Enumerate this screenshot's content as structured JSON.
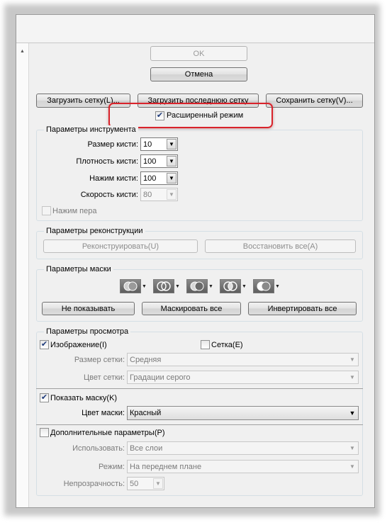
{
  "window": {
    "ok_label": "OK",
    "cancel_label": "Отмена"
  },
  "mesh": {
    "load_mesh": "Загрузить сетку(L)...",
    "load_last_mesh": "Загрузить последнюю сетку",
    "save_mesh": "Сохранить сетку(V)..."
  },
  "advanced_mode": {
    "label": "Расширенный режим",
    "checked": true
  },
  "tool_options": {
    "legend": "Параметры инструмента",
    "brush_size": {
      "label": "Размер кисти:",
      "value": "10"
    },
    "brush_density": {
      "label": "Плотность кисти:",
      "value": "100"
    },
    "brush_pressure": {
      "label": "Нажим кисти:",
      "value": "100"
    },
    "brush_rate": {
      "label": "Скорость кисти:",
      "value": "80"
    },
    "stylus_pressure": {
      "label": "Нажим пера",
      "checked": false
    }
  },
  "reconstruct_options": {
    "legend": "Параметры реконструкции",
    "reconstruct": "Реконструировать(U)",
    "restore_all": "Восстановить все(A)"
  },
  "mask_options": {
    "legend": "Параметры маски",
    "icons": [
      "mask-replace-icon",
      "mask-add-icon",
      "mask-subtract-icon",
      "mask-intersect-icon",
      "mask-invert-icon"
    ],
    "none": "Не показывать",
    "mask_all": "Маскировать все",
    "invert_all": "Инвертировать все"
  },
  "view_options": {
    "legend": "Параметры просмотра",
    "show_image": {
      "label": "Изображение(I)",
      "checked": true
    },
    "show_mesh": {
      "label": "Сетка(E)",
      "checked": false
    },
    "mesh_size": {
      "label": "Размер сетки:",
      "value": "Средняя"
    },
    "mesh_color": {
      "label": "Цвет сетки:",
      "value": "Градации серого"
    },
    "show_mask": {
      "label": "Показать маску(K)",
      "checked": true
    },
    "mask_color": {
      "label": "Цвет маски:",
      "value": "Красный"
    },
    "show_backdrop": {
      "label": "Дополнительные параметры(P)",
      "checked": false
    },
    "use": {
      "label": "Использовать:",
      "value": "Все слои"
    },
    "mode": {
      "label": "Режим:",
      "value": "На переднем плане"
    },
    "opacity": {
      "label": "Непрозрачность:",
      "value": "50"
    }
  },
  "colors": {
    "highlight": "#d9232b",
    "panel": "#f0f0f0"
  }
}
